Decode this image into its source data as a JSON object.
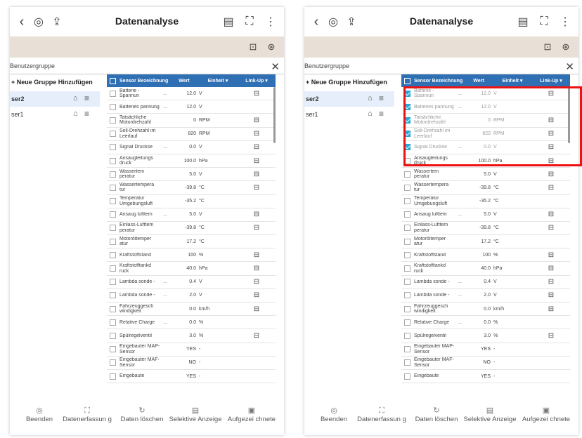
{
  "app": {
    "title": "Datenanalyse",
    "group_header": "Benutzergruppe",
    "add_group": "+ Neue Gruppe Hinzufügen",
    "groups": [
      "ser2",
      "ser1"
    ]
  },
  "icons": {
    "back": "‹",
    "car_diag": "◎",
    "export": "⇪",
    "info_car": "▤",
    "fullscreen": "⛶",
    "more": "⋮",
    "car": "⊡",
    "steering": "⊛",
    "close": "✕",
    "trash": "⌂",
    "menu": "≡",
    "link": "⊟"
  },
  "table": {
    "headers": {
      "name": "Sensor Bezeichnung",
      "value": "Wert",
      "unit": "Einheit ▾",
      "link": "Link-Up ▾"
    },
    "rows": [
      {
        "name": "Batterie - Spannun",
        "dots": "...",
        "value": "12.0",
        "unit": "V",
        "link": true
      },
      {
        "name": "Batteries pannung",
        "dots": "...",
        "value": "12.0",
        "unit": "V",
        "link": false
      },
      {
        "name": "Tatsächliche Motordrehzahl",
        "dots": "",
        "value": "0",
        "unit": "RPM",
        "link": true
      },
      {
        "name": "Soll-Drehzahl im Leerlauf",
        "dots": "",
        "value": "820",
        "unit": "RPM",
        "link": true
      },
      {
        "name": "Signal Druckse",
        "dots": "...",
        "value": "0.0",
        "unit": "V",
        "link": true
      },
      {
        "name": "Ansaugleitungs druck",
        "dots": "",
        "value": "100.0",
        "unit": "hPa",
        "link": true
      },
      {
        "name": "Wassertem peratur",
        "dots": "",
        "value": "5.0",
        "unit": "V",
        "link": true
      },
      {
        "name": "Wassertempera tur",
        "dots": "",
        "value": "-39.8",
        "unit": "°C",
        "link": true
      },
      {
        "name": "Temperatur Umgebungsluft",
        "dots": "",
        "value": "-35.2",
        "unit": "°C",
        "link": false
      },
      {
        "name": "Ansaug lufttem",
        "dots": "...",
        "value": "5.0",
        "unit": "V",
        "link": true
      },
      {
        "name": "Einlass-Lufttem peratur",
        "dots": "",
        "value": "-39.8",
        "unit": "°C",
        "link": true
      },
      {
        "name": "Motoröltemper atur",
        "dots": "",
        "value": "17.2",
        "unit": "°C",
        "link": false
      },
      {
        "name": "Kraftstoffstand",
        "dots": "",
        "value": "100",
        "unit": "%",
        "link": true
      },
      {
        "name": "Kraftstofftankd ruck",
        "dots": "",
        "value": "40.0",
        "unit": "hPa",
        "link": true
      },
      {
        "name": "Lambda sonde -",
        "dots": "...",
        "value": "0.4",
        "unit": "V",
        "link": true
      },
      {
        "name": "Lambda sonde -",
        "dots": "...",
        "value": "2.0",
        "unit": "V",
        "link": true
      },
      {
        "name": "Fahrzeuggesch windigkeit",
        "dots": "",
        "value": "0.0",
        "unit": "km/h",
        "link": true
      },
      {
        "name": "Relative Charge",
        "dots": "...",
        "value": "0.0",
        "unit": "%",
        "link": false
      },
      {
        "name": "Spülregelventil",
        "dots": "",
        "value": "3.0",
        "unit": "%",
        "link": true
      },
      {
        "name": "Eingebauter MAP-Sensor",
        "dots": "",
        "value": "YES",
        "unit": "-",
        "link": false
      },
      {
        "name": "Eingebauter MAF-Sensor",
        "dots": "",
        "value": "NO",
        "unit": "-",
        "link": false
      },
      {
        "name": "Eingebaute",
        "dots": "",
        "value": "YES",
        "unit": "-",
        "link": false
      }
    ]
  },
  "bottom": {
    "exit": "Beenden",
    "record": "Datenerfassun g",
    "clear": "Daten löschen",
    "select": "Selektive Anzeige",
    "recorded": "Aufgezei chnete"
  },
  "colors": {
    "accent": "#2f6fb4",
    "check": "#2aa7d8",
    "highlight": "#e11111",
    "beige": "#e8dfd6"
  }
}
